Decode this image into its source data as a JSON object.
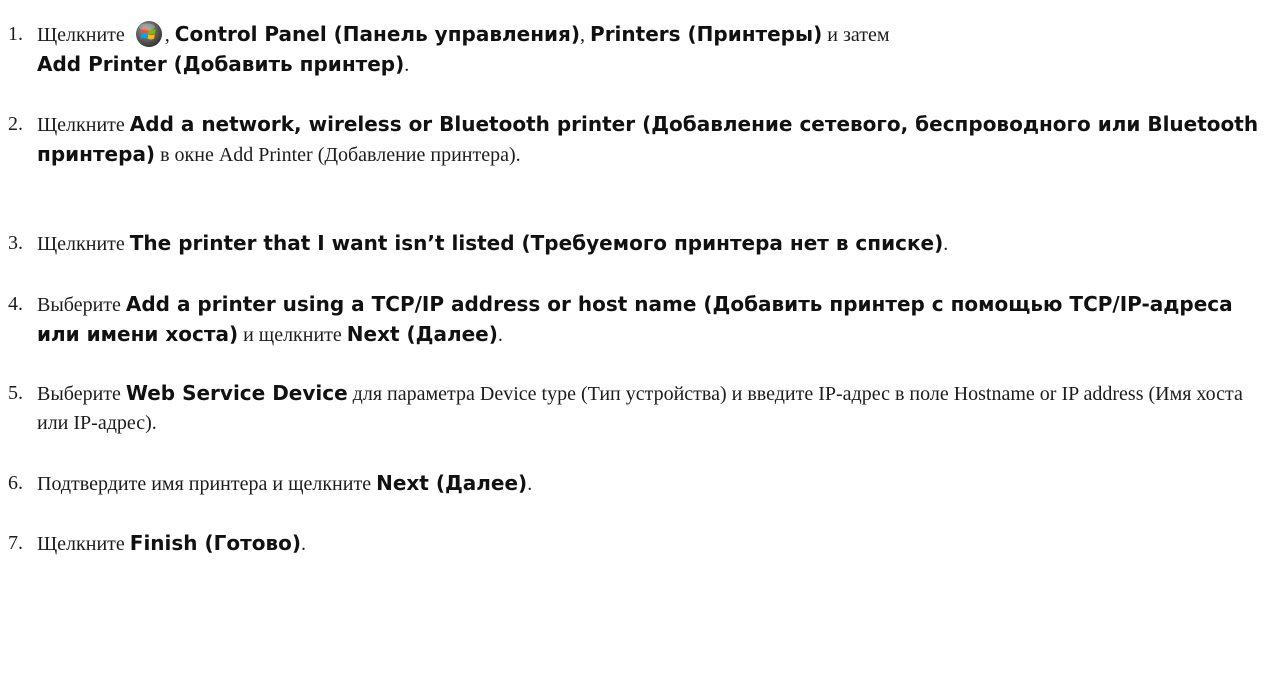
{
  "colors": {
    "text": "#1c1c1c",
    "bold_text": "#111111",
    "logo_glass": "#5a5a5a",
    "logo_flag_red": "#f25022",
    "logo_flag_green": "#7fba00",
    "logo_flag_blue": "#00a4ef",
    "logo_flag_yellow": "#ffb900"
  },
  "icons": {
    "start_button": "windows-start-orb-icon"
  },
  "steps": [
    {
      "number": "1.",
      "t0": "Щелкните",
      "t1": ",",
      "b1": "Control Panel (Панель управления)",
      "t2": ",",
      "b2": "Printers (Принтеры)",
      "t3": "и затем",
      "b3": "Add Printer (Добавить принтер)",
      "t4": "."
    },
    {
      "number": "2.",
      "t0": "Щелкните",
      "b1": "Add a network, wireless or Bluetooth printer (Добавление сетевого, беспроводного или Bluetooth принтера)",
      "t1": "в окне Add Printer (Добавление принтера)."
    },
    {
      "number": "3.",
      "t0": "Щелкните",
      "b1": "The printer that I want isn’t listed (Требуемого принтера нет в списке)",
      "t1": "."
    },
    {
      "number": "4.",
      "t0": "Выберите",
      "b1": "Add a printer using a TCP/IP address or host name (Добавить принтер с помощью TCP/IP-адреса или имени хоста)",
      "t1": "и щелкните",
      "b2": "Next (Далее)",
      "t2": "."
    },
    {
      "number": "5.",
      "t0": "Выберите",
      "b1": "Web Service Device",
      "t1": "для параметра Device type (Тип устройства) и введите IP-адрес в поле Hostname or IP address (Имя хоста или IP-адрес)."
    },
    {
      "number": "6.",
      "t0": "Подтвердите имя принтера и щелкните",
      "b1": "Next (Далее)",
      "t1": "."
    },
    {
      "number": "7.",
      "t0": "Щелкните",
      "b1": "Finish (Готово)",
      "t1": "."
    }
  ]
}
